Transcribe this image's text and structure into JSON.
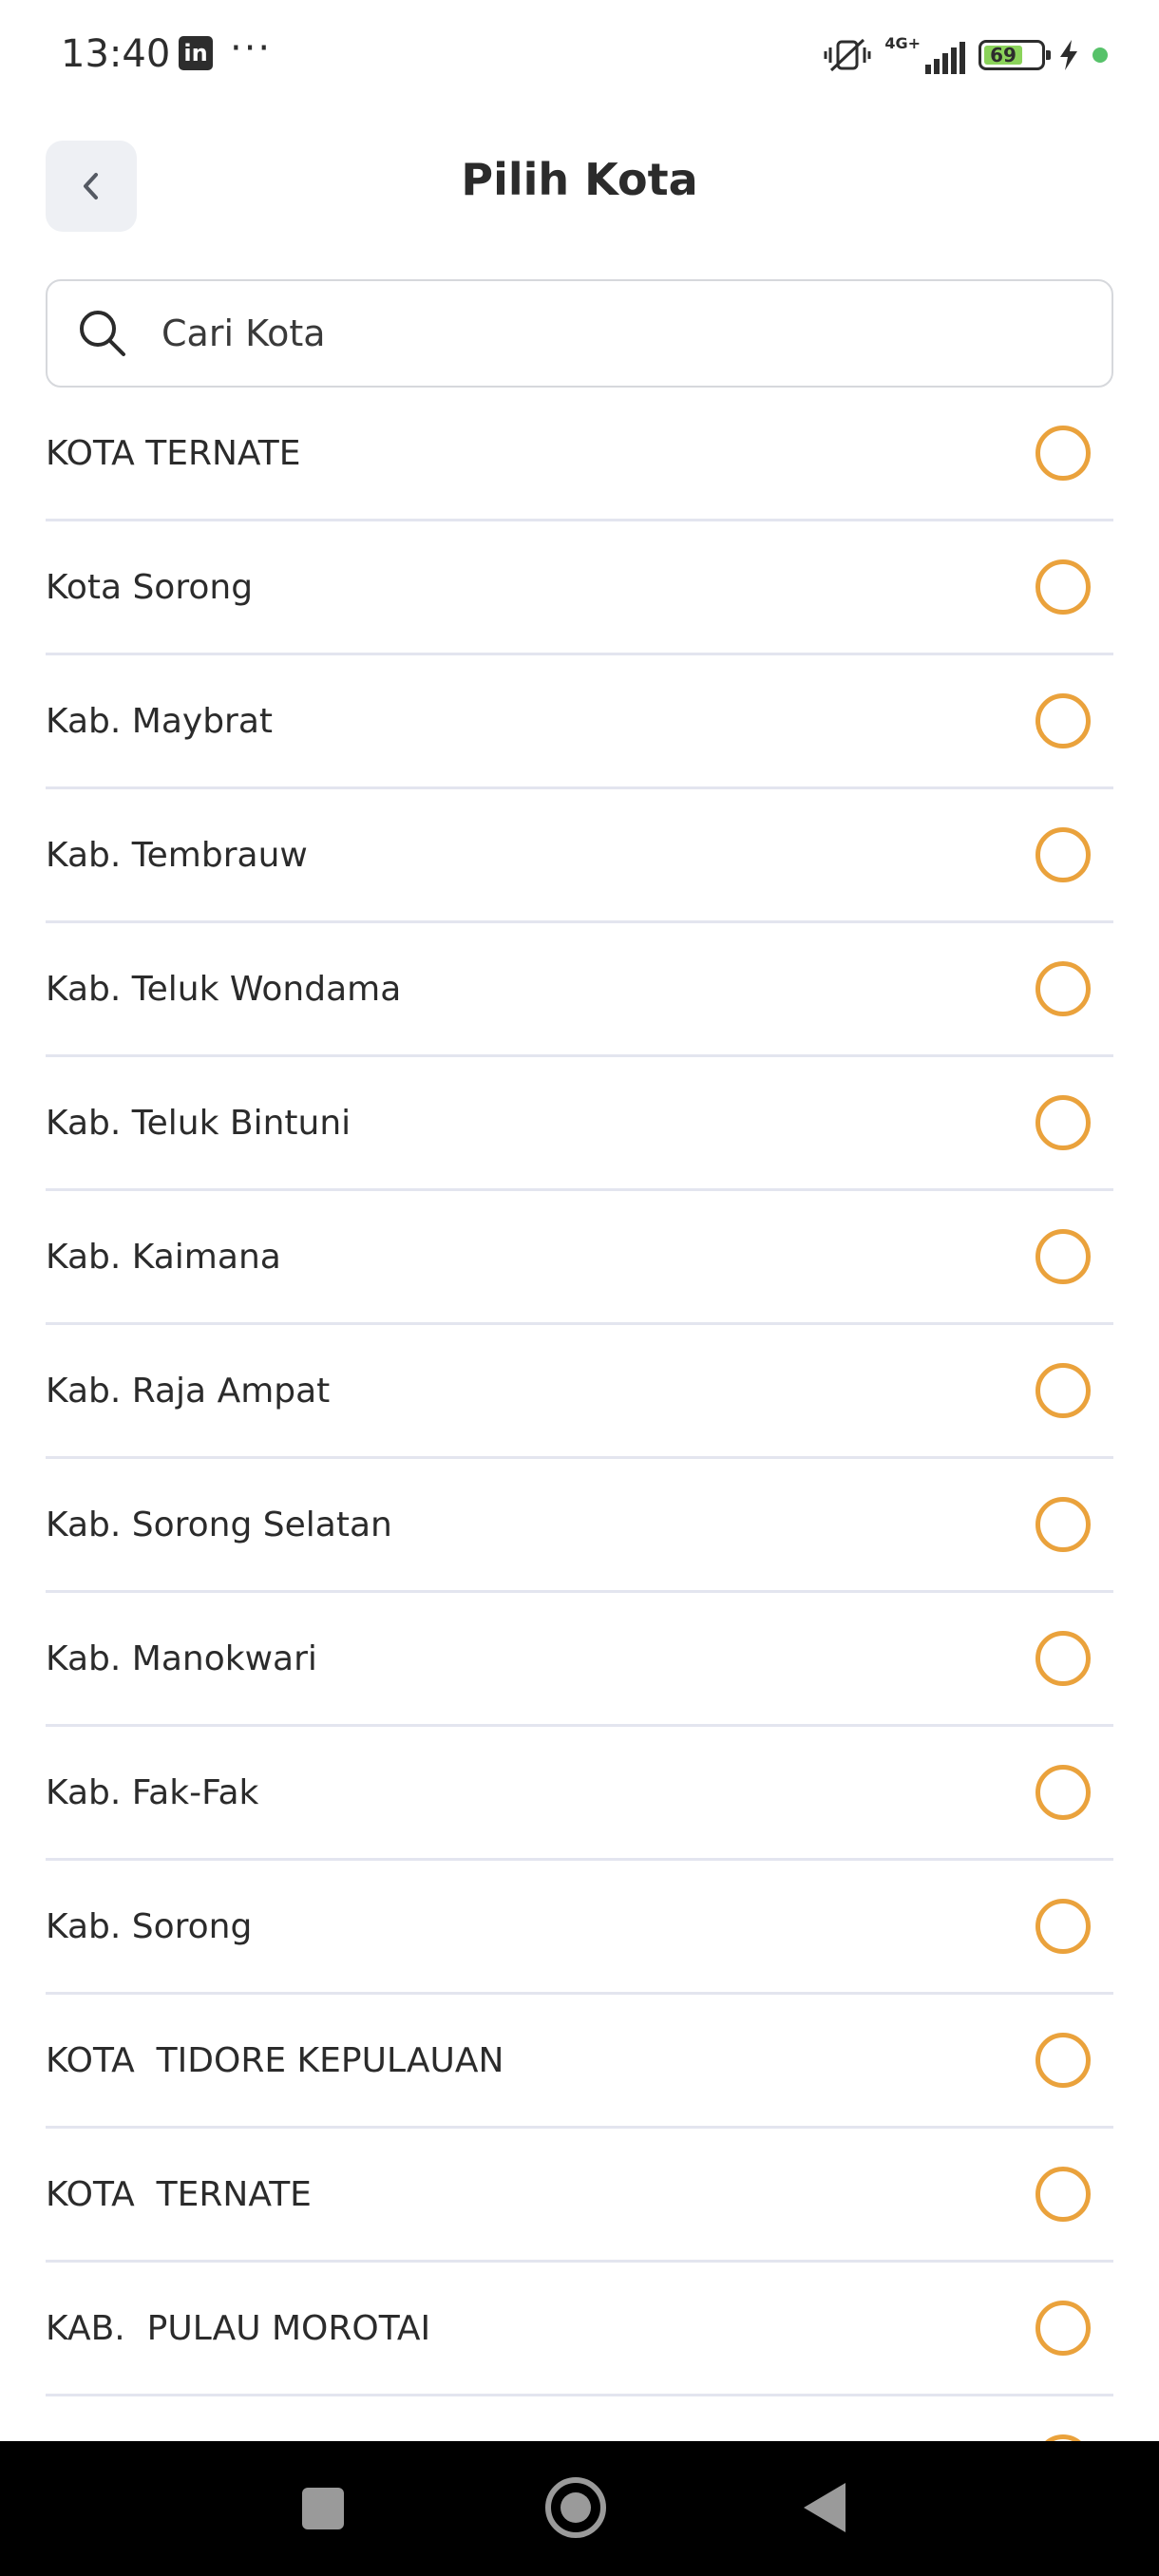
{
  "status_bar": {
    "time": "13:40",
    "linkedin_icon_text": "in",
    "more_icon_text": "···",
    "network_label": "4G+",
    "battery_level": "69",
    "icons": [
      "linkedin-icon",
      "more-icon",
      "mute-vibrate-icon",
      "signal-icon",
      "battery-icon",
      "charging-icon"
    ]
  },
  "header": {
    "title": "Pilih Kota",
    "back_icon": "chevron-left-icon"
  },
  "search": {
    "placeholder": "Cari Kota",
    "value": "",
    "icon": "search-icon"
  },
  "cities": [
    {
      "label": "KOTA TERNATE",
      "selected": false
    },
    {
      "label": "Kota Sorong",
      "selected": false
    },
    {
      "label": "Kab. Maybrat",
      "selected": false
    },
    {
      "label": "Kab. Tembrauw",
      "selected": false
    },
    {
      "label": "Kab. Teluk Wondama",
      "selected": false
    },
    {
      "label": "Kab. Teluk Bintuni",
      "selected": false
    },
    {
      "label": "Kab. Kaimana",
      "selected": false
    },
    {
      "label": "Kab. Raja Ampat",
      "selected": false
    },
    {
      "label": "Kab. Sorong Selatan",
      "selected": false
    },
    {
      "label": "Kab. Manokwari",
      "selected": false
    },
    {
      "label": "Kab. Fak-Fak",
      "selected": false
    },
    {
      "label": "Kab. Sorong",
      "selected": false
    },
    {
      "label": "KOTA  TIDORE KEPULAUAN",
      "selected": false
    },
    {
      "label": "KOTA  TERNATE",
      "selected": false
    },
    {
      "label": "KAB.  PULAU MOROTAI",
      "selected": false
    }
  ],
  "colors": {
    "radio_accent": "#eaa23c",
    "divider": "#e3e5ef",
    "back_button_bg": "#eef0f4"
  },
  "nav_bar": {
    "icons": [
      "recent-apps-icon",
      "home-icon",
      "back-icon"
    ]
  }
}
